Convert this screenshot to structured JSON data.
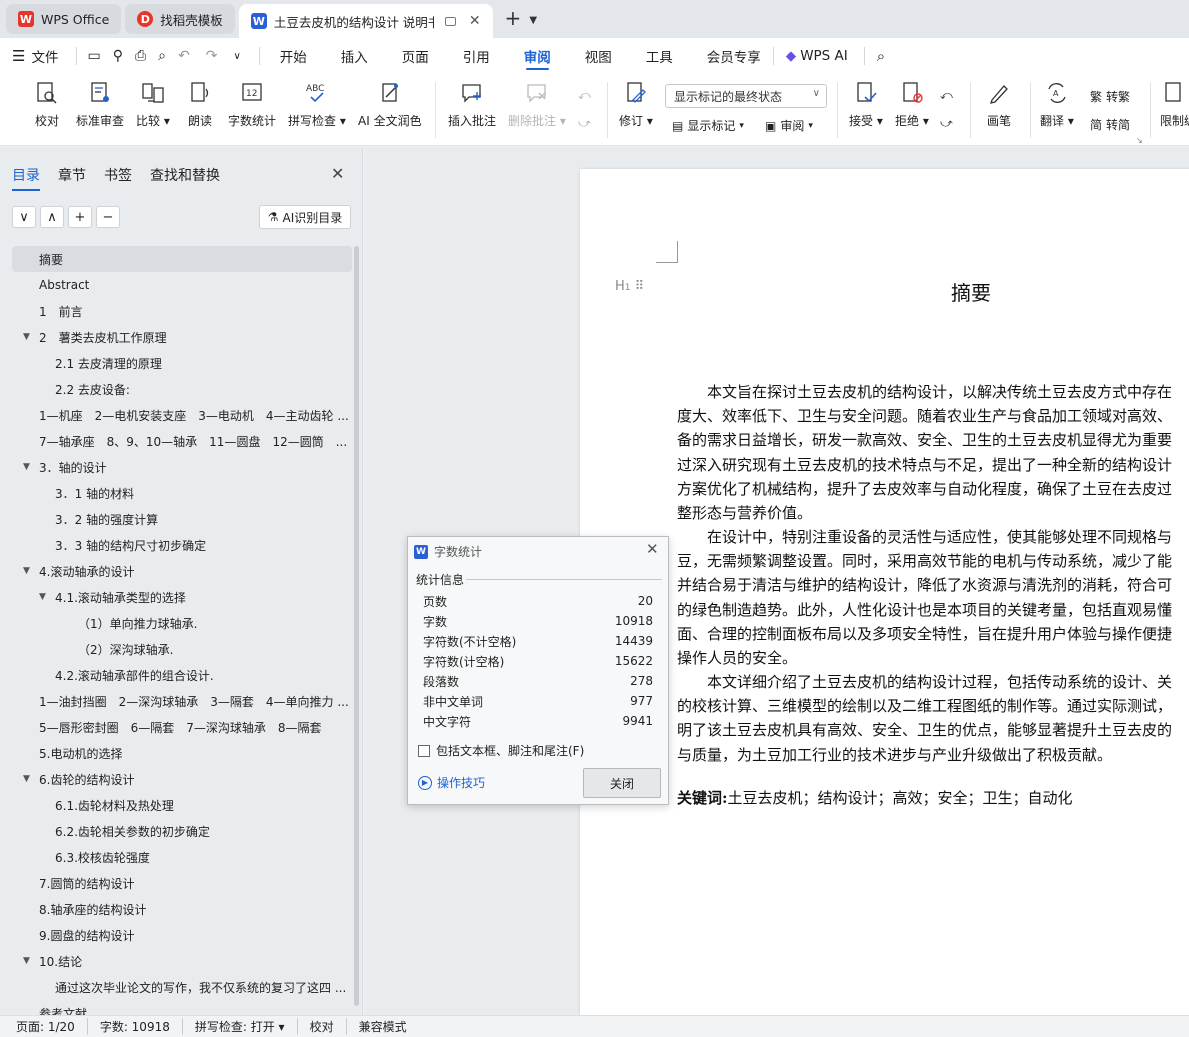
{
  "tabs": [
    {
      "label": "WPS Office",
      "icon": "wps-logo-icon",
      "color": "#e8352c"
    },
    {
      "label": "找稻壳模板",
      "icon": "docer-logo-icon",
      "color": "#e8352c"
    },
    {
      "label": "土豆去皮机的结构设计 说明书",
      "icon": "word-doc-icon",
      "color": "#2b5fd6"
    }
  ],
  "menu": {
    "file_label": "文件",
    "tabs": [
      "开始",
      "插入",
      "页面",
      "引用",
      "审阅",
      "视图",
      "工具",
      "会员专享"
    ],
    "active_tab": "审阅",
    "ai_label": "WPS AI"
  },
  "ribbon": {
    "proofread": "校对",
    "standard_review": "标准审查",
    "compare": "比较",
    "read_aloud": "朗读",
    "word_count": "字数统计",
    "spell_check": "拼写检查",
    "ai_proofread": "AI 全文润色",
    "insert_comment": "插入批注",
    "delete_comment": "删除批注",
    "track_changes": "修订",
    "markup_select": "显示标记的最终状态",
    "show_markup": "显示标记",
    "review": "审阅",
    "accept": "接受",
    "reject": "拒绝",
    "pen": "画笔",
    "translate": "翻译",
    "to_traditional": "转繁",
    "to_simplified": "转简",
    "restrict": "限制编"
  },
  "nav": {
    "tabs": [
      "目录",
      "章节",
      "书签",
      "查找和替换"
    ],
    "active_tab": "目录",
    "ai_toc_label": "AI识别目录",
    "toc": [
      {
        "text": "摘要",
        "level": 1,
        "selected": true
      },
      {
        "text": "Abstract",
        "level": 1
      },
      {
        "text": "1　前言",
        "level": 1
      },
      {
        "text": "2　薯类去皮机工作原理",
        "level": 1,
        "expanded": true
      },
      {
        "text": "2.1 去皮清理的原理",
        "level": 2
      },
      {
        "text": "2.2 去皮设备:",
        "level": 2
      },
      {
        "text": "1—机座　2—电机安装支座　3—电动机　4—主动齿轮 ...",
        "level": 1
      },
      {
        "text": "7—轴承座　8、9、10—轴承　11—圆盘　12—圆筒　...",
        "level": 1
      },
      {
        "text": "3．轴的设计",
        "level": 1,
        "expanded": true
      },
      {
        "text": "3．1 轴的材料",
        "level": 2
      },
      {
        "text": "3．2 轴的强度计算",
        "level": 2
      },
      {
        "text": "3．3 轴的结构尺寸初步确定",
        "level": 2
      },
      {
        "text": "4.滚动轴承的设计",
        "level": 1,
        "expanded": true
      },
      {
        "text": "4.1.滚动轴承类型的选择",
        "level": 2,
        "expanded": true
      },
      {
        "text": "（1）单向推力球轴承.",
        "level": 3
      },
      {
        "text": "（2）深沟球轴承.",
        "level": 3
      },
      {
        "text": "4.2.滚动轴承部件的组合设计.",
        "level": 2
      },
      {
        "text": "1—油封挡圈　2—深沟球轴承　3—隔套　4—单向推力 ...",
        "level": 1
      },
      {
        "text": "5—唇形密封圈　6—隔套　7—深沟球轴承　8—隔套",
        "level": 1
      },
      {
        "text": "5.电动机的选择",
        "level": 1
      },
      {
        "text": "6.齿轮的结构设计",
        "level": 1,
        "expanded": true
      },
      {
        "text": "6.1.齿轮材料及热处理",
        "level": 2
      },
      {
        "text": "6.2.齿轮相关参数的初步确定",
        "level": 2
      },
      {
        "text": "6.3.校核齿轮强度",
        "level": 2
      },
      {
        "text": "7.圆筒的结构设计",
        "level": 1
      },
      {
        "text": "8.轴承座的结构设计",
        "level": 1
      },
      {
        "text": "9.圆盘的结构设计",
        "level": 1
      },
      {
        "text": "10.结论",
        "level": 1,
        "expanded": true
      },
      {
        "text": "通过这次毕业论文的写作，我不仅系统的复习了这四 ...",
        "level": 2
      },
      {
        "text": "参考文献",
        "level": 1
      }
    ]
  },
  "document": {
    "heading_marker": "H",
    "title": "摘要",
    "paragraphs": [
      [
        "　　本文旨在探讨土豆去皮机的结构设计，以解决传统土豆去皮方式中存在",
        "度大、效率低下、卫生与安全问题。随着农业生产与食品加工领域对高效、",
        "备的需求日益增长，研发一款高效、安全、卫生的土豆去皮机显得尤为重要",
        "过深入研究现有土豆去皮机的技术特点与不足，提出了一种全新的结构设计",
        "方案优化了机械结构，提升了去皮效率与自动化程度，确保了土豆在去皮过",
        "整形态与营养价值。"
      ],
      [
        "　　在设计中，特别注重设备的灵活性与适应性，使其能够处理不同规格与",
        "豆，无需频繁调整设置。同时，采用高效节能的电机与传动系统，减少了能",
        "并结合易于清洁与维护的结构设计，降低了水资源与清洗剂的消耗，符合可",
        "的绿色制造趋势。此外，人性化设计也是本项目的关键考量，包括直观易懂",
        "面、合理的控制面板布局以及多项安全特性，旨在提升用户体验与操作便捷",
        "操作人员的安全。"
      ],
      [
        "　　本文详细介绍了土豆去皮机的结构设计过程，包括传动系统的设计、关",
        "的校核计算、三维模型的绘制以及二维工程图纸的制作等。通过实际测试，",
        "明了该土豆去皮机具有高效、安全、卫生的优点，能够显著提升土豆去皮的",
        "与质量，为土豆加工行业的技术进步与产业升级做出了积极贡献。"
      ]
    ],
    "keywords_label": "关键词:",
    "keywords": "土豆去皮机；结构设计；高效；安全；卫生；自动化"
  },
  "dialog": {
    "title": "字数统计",
    "section": "统计信息",
    "stats": [
      {
        "label": "页数",
        "value": "20"
      },
      {
        "label": "字数",
        "value": "10918"
      },
      {
        "label": "字符数(不计空格)",
        "value": "14439"
      },
      {
        "label": "字符数(计空格)",
        "value": "15622"
      },
      {
        "label": "段落数",
        "value": "278"
      },
      {
        "label": "非中文单词",
        "value": "977"
      },
      {
        "label": "中文字符",
        "value": "9941"
      }
    ],
    "include_label": "包括文本框、脚注和尾注(F)",
    "tips_label": "操作技巧",
    "close_label": "关闭"
  },
  "status": {
    "page": "页面: 1/20",
    "words": "字数: 10918",
    "spell": "拼写检查: 打开",
    "proof": "校对",
    "compat": "兼容模式"
  },
  "colors": {
    "accent": "#1e63d6",
    "wps_red": "#e8352c",
    "word_blue": "#2b5fd6"
  }
}
